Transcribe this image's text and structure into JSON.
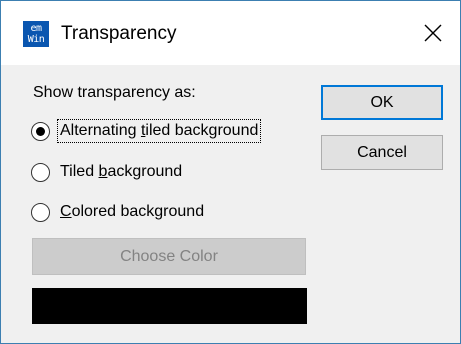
{
  "window": {
    "title": "Transparency",
    "icon_lines": [
      "em",
      "Win"
    ],
    "icon_name": "emwin-app-icon"
  },
  "dialog": {
    "prompt": "Show transparency as:",
    "options": [
      {
        "pre": "Alternating ",
        "accel": "t",
        "post": "iled background",
        "checked": true
      },
      {
        "pre": "Tiled ",
        "accel": "b",
        "post": "ackground",
        "checked": false
      },
      {
        "pre": "",
        "accel": "C",
        "post": "olored background",
        "checked": false
      }
    ],
    "choose_color_label": "Choose Color",
    "swatch_color": "#000000"
  },
  "buttons": {
    "ok": "OK",
    "cancel": "Cancel"
  },
  "colors": {
    "accent": "#0078d7",
    "window_border": "#3c7fb1",
    "icon_bg": "#0a56b0"
  }
}
